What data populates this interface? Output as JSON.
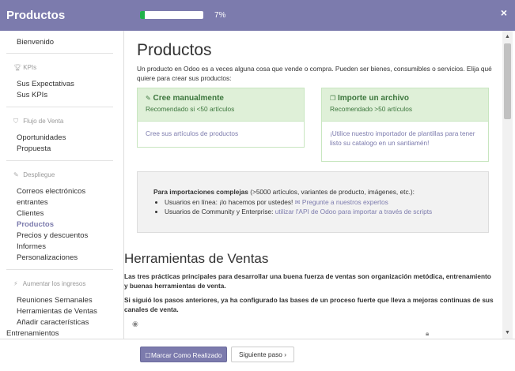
{
  "header": {
    "title": "Productos",
    "progress_pct": 7,
    "progress_label": "7%",
    "close_glyph": "×"
  },
  "sidebar": {
    "welcome": "Bienvenido",
    "cat_kpis": "KPIs",
    "kpis_items": [
      "Sus Expectativas",
      "Sus KPIs"
    ],
    "cat_flujo": "Flujo de Venta",
    "flujo_items": [
      "Oportunidades",
      "Propuesta"
    ],
    "cat_despliegue": "Despliegue",
    "despliegue_items": [
      "Correos electrónicos",
      "entrantes",
      "Clientes",
      "Productos",
      "Precios y descuentos",
      "Informes",
      "Personalizaciones"
    ],
    "cat_aumentar": "Aumentar los ingresos",
    "aumentar_items": [
      "Reuniones Semanales",
      "Herramientas de Ventas",
      "Añadir características"
    ],
    "overflow_item": "Entrenamientos"
  },
  "main": {
    "title": "Productos",
    "intro": "Un producto en Odoo es a veces alguna cosa que vende o compra. Pueden ser bienes, consumibles o servicios. Elija qué quiere para crear sus productos:",
    "card_manual": {
      "title": "Cree manualmente",
      "subtitle": "Recomendado si <50 artículos",
      "link": "Cree sus artículos de productos"
    },
    "card_import": {
      "title": "Importe un archivo",
      "subtitle": "Recomendado >50 artículos",
      "link": "¡Utilice nuestro importador de plantillas para tener listo su catalogo en un santiamén!"
    },
    "complex": {
      "bold": "Para importaciones complejas",
      "rest": " (>5000 artículos, variantes de producto, imágenes, etc.):",
      "bullet1_text": "Usuarios en línea: ¡lo hacemos por ustedes! ",
      "bullet1_link": "Pregunte a nuestros expertos",
      "bullet2_text": "Usuarios de Community y Enterprise: ",
      "bullet2_link": "utilizar l'API de Odoo para importar a través de scripts"
    },
    "section_title": "Herramientas de Ventas",
    "para1": "Las tres prácticas principales para desarrollar una buena fuerza de ventas son organización metódica, entrenamiento y buenas herramientas de venta.",
    "para2": "Si siguió los pasos anteriores, ya ha configurado las bases de un proceso fuerte que lleva a mejoras continuas de sus canales de venta."
  },
  "footer": {
    "done_label": "Marcar Como Realizado",
    "next_label": "Siguiente paso"
  },
  "icons": {
    "kpis": "trophy-icon",
    "flujo": "tag-icon",
    "despliegue": "wrench-icon",
    "aumentar": "bolt-icon",
    "manual": "edit-icon",
    "import": "copy-icon",
    "envelope": "envelope-icon",
    "eye": "eye-icon",
    "lock": "lock-icon",
    "next": "chevron-right-icon"
  },
  "colors": {
    "header": "#7c7bad",
    "accent": "#7c7bad",
    "success_bg": "#dff0d8",
    "success_text": "#3c763d",
    "progress": "#21b24b"
  }
}
